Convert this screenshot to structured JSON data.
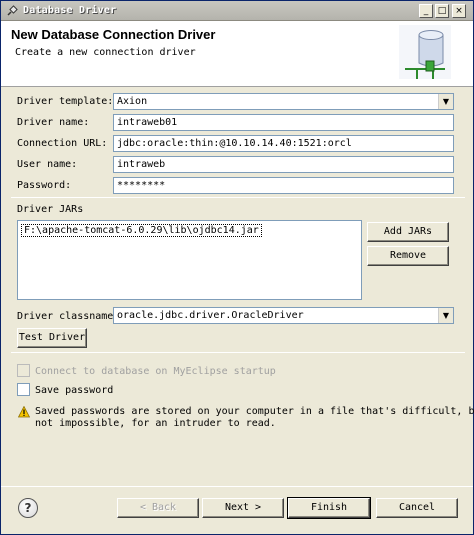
{
  "window": {
    "title": "Database Driver",
    "controls": {
      "minimize": "_",
      "maximize": "□",
      "close": "×"
    }
  },
  "header": {
    "title": "New Database Connection Driver",
    "description": "Create a new connection driver"
  },
  "form": {
    "driver_template": {
      "label": "Driver template:",
      "value": "Axion"
    },
    "driver_name": {
      "label": "Driver name:",
      "value": "intraweb01"
    },
    "connection_url": {
      "label": "Connection URL:",
      "value": "jdbc:oracle:thin:@10.10.14.40:1521:orcl"
    },
    "user_name": {
      "label": "User name:",
      "value": "intraweb"
    },
    "password": {
      "label": "Password:",
      "value": "********"
    }
  },
  "jars": {
    "label": "Driver JARs",
    "items": [
      "F:\\apache-tomcat-6.0.29\\lib\\ojdbc14.jar"
    ],
    "add_label": "Add JARs",
    "remove_label": "Remove"
  },
  "classname": {
    "label": "Driver classname:",
    "value": "oracle.jdbc.driver.OracleDriver"
  },
  "test_driver_label": "Test Driver",
  "options": {
    "connect_on_startup": {
      "label": "Connect to database on MyEclipse startup",
      "checked": false,
      "enabled": false
    },
    "save_password": {
      "label": "Save password",
      "checked": false,
      "enabled": true
    }
  },
  "warning": {
    "line1": "Saved passwords are stored on your computer in a file that's difficult, but",
    "line2": "not impossible, for an intruder to read."
  },
  "footer": {
    "back_label": "< Back",
    "next_label": "Next >",
    "finish_label": "Finish",
    "cancel_label": "Cancel"
  },
  "icons": {
    "app": "plug-icon",
    "header": "database-icon",
    "warning": "warning-icon",
    "help": "help-icon"
  },
  "colors": {
    "dialog_bg": "#ece9d8",
    "field_border": "#7f9db9",
    "warning_yellow": "#f5c400"
  }
}
